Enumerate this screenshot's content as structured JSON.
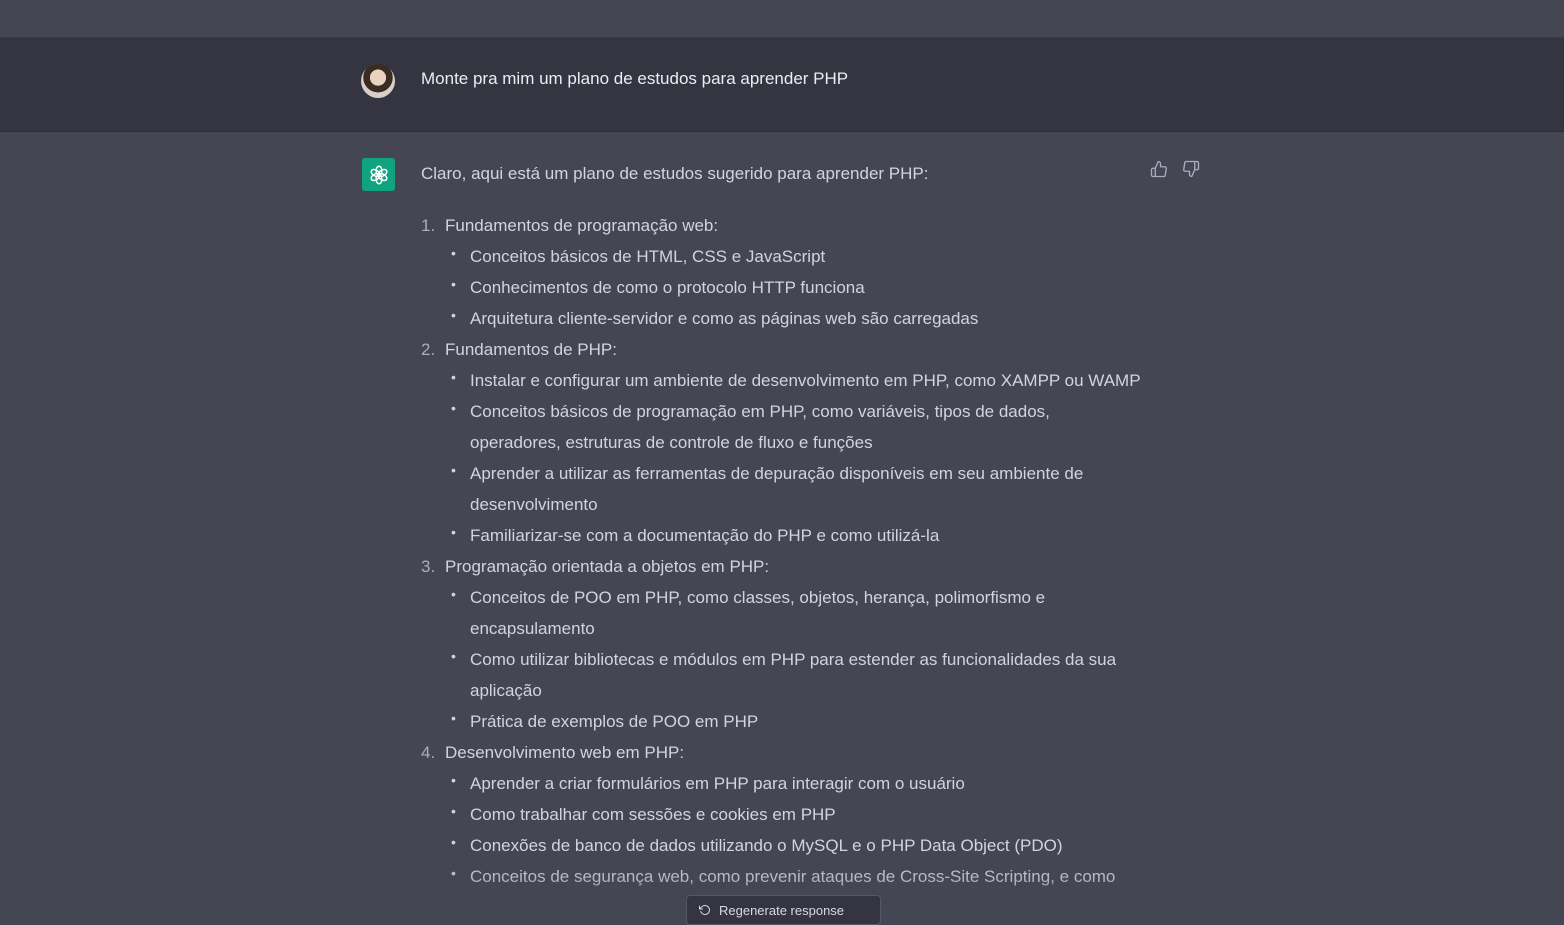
{
  "user_message": {
    "text": "Monte pra mim um plano de estudos para aprender PHP"
  },
  "assistant_message": {
    "intro": "Claro, aqui está um plano de estudos sugerido para aprender PHP:",
    "sections": [
      {
        "number": "1.",
        "title": "Fundamentos de programação web:",
        "items": [
          "Conceitos básicos de HTML, CSS e JavaScript",
          "Conhecimentos de como o protocolo HTTP funciona",
          "Arquitetura cliente-servidor e como as páginas web são carregadas"
        ]
      },
      {
        "number": "2.",
        "title": "Fundamentos de PHP:",
        "items": [
          "Instalar e configurar um ambiente de desenvolvimento em PHP, como XAMPP ou WAMP",
          "Conceitos básicos de programação em PHP, como variáveis, tipos de dados, operadores, estruturas de controle de fluxo e funções",
          "Aprender a utilizar as ferramentas de depuração disponíveis em seu ambiente de desenvolvimento",
          "Familiarizar-se com a documentação do PHP e como utilizá-la"
        ]
      },
      {
        "number": "3.",
        "title": "Programação orientada a objetos em PHP:",
        "items": [
          "Conceitos de POO em PHP, como classes, objetos, herança, polimorfismo e encapsulamento",
          "Como utilizar bibliotecas e módulos em PHP para estender as funcionalidades da sua aplicação",
          "Prática de exemplos de POO em PHP"
        ]
      },
      {
        "number": "4.",
        "title": "Desenvolvimento web em PHP:",
        "items": [
          "Aprender a criar formulários em PHP para interagir com o usuário",
          "Como trabalhar com sessões e cookies em PHP",
          "Conexões de banco de dados utilizando o MySQL e o PHP Data Object (PDO)",
          "Conceitos de segurança web, como prevenir ataques de Cross-Site Scripting, e como"
        ]
      }
    ]
  },
  "regenerate_button": {
    "label": "Regenerate response"
  },
  "icons": {
    "thumbs_up": "thumbs-up-icon",
    "thumbs_down": "thumbs-down-icon",
    "regenerate": "refresh-icon",
    "assistant_logo": "openai-logo-icon"
  },
  "colors": {
    "assistant_bg": "#444654",
    "user_bg": "#343541",
    "logo_bg": "#10a37f"
  }
}
